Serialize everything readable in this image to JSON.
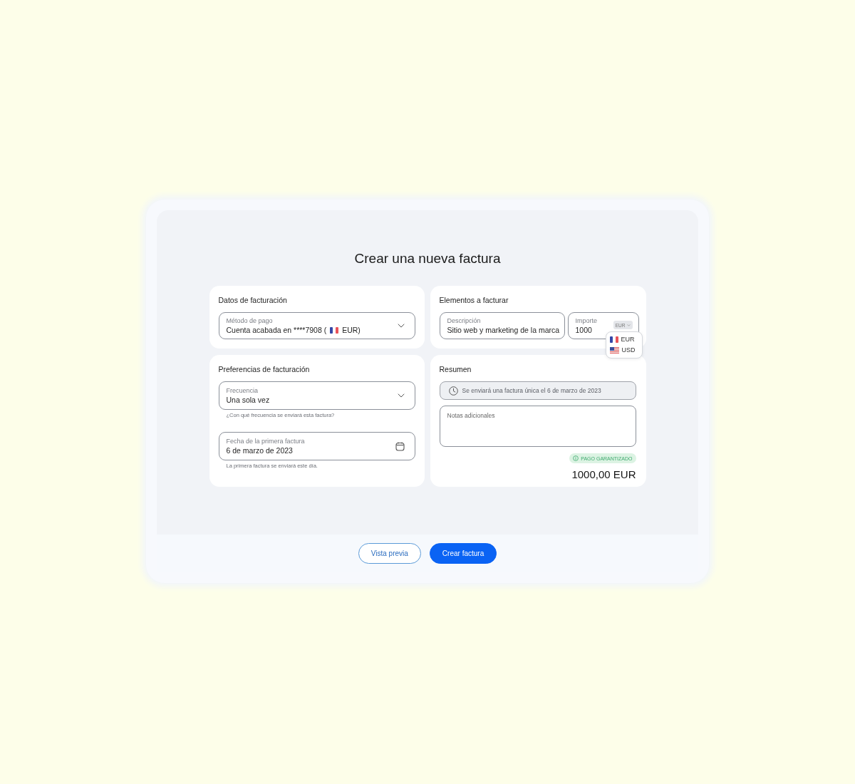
{
  "dialog": {
    "title": "Crear una nueva factura"
  },
  "billing_data": {
    "heading": "Datos de facturación",
    "payment_method": {
      "label": "Método de pago",
      "value": "Cuenta acabada en ****7908  (",
      "value_suffix": "EUR)"
    }
  },
  "items": {
    "heading": "Elementos a facturar",
    "description": {
      "label": "Descripción",
      "value": "Sitio web y marketing de la marca"
    },
    "amount": {
      "label": "Importe",
      "value": "1000",
      "currency": "EUR",
      "menu_open": true,
      "options": [
        {
          "kind": "eur",
          "label": "EUR"
        },
        {
          "kind": "usd",
          "label": "USD"
        }
      ]
    }
  },
  "preferences": {
    "heading": "Preferencias de facturación",
    "fields": [
      {
        "kind": "select",
        "label": "Frecuencia",
        "value": "Una sola vez",
        "helper": "¿Con qué frecuencia se enviará esta factura?"
      },
      {
        "kind": "date",
        "label": "Fecha de la primera factura",
        "value": "6 de marzo de 2023",
        "helper": "La primera factura se enviará este día."
      }
    ]
  },
  "summary": {
    "heading": "Resumen",
    "notice": "Se enviará una factura única el 6 de marzo de 2023",
    "notes": {
      "placeholder": "Notas adicionales"
    },
    "badge": "PAGO GARANTIZADO",
    "total": "1000,00 EUR"
  },
  "footer": {
    "buttons": [
      {
        "kind": "secondary",
        "label": "Vista previa"
      },
      {
        "kind": "primary",
        "label": "Crear factura"
      }
    ]
  }
}
